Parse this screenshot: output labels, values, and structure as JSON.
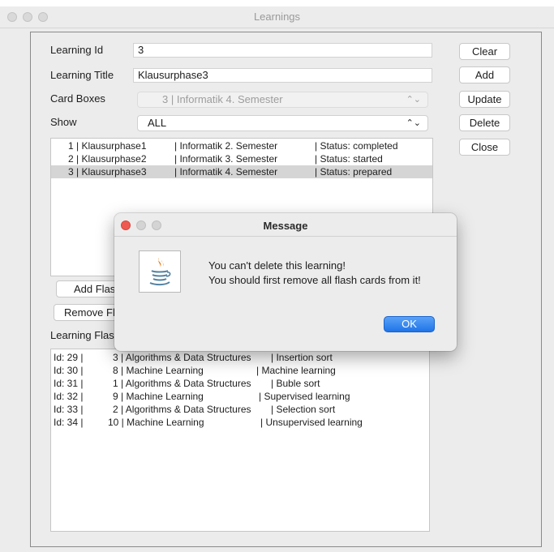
{
  "window": {
    "title": "Learnings"
  },
  "form": {
    "learning_id_label": "Learning Id",
    "learning_id_value": "3",
    "learning_title_label": "Learning Title",
    "learning_title_value": "Klausurphase3",
    "card_boxes_label": "Card Boxes",
    "card_boxes_value": "3 | Informatik 4. Semester",
    "show_label": "Show",
    "show_value": "ALL"
  },
  "buttons": {
    "clear": "Clear",
    "add": "Add",
    "update": "Update",
    "delete": "Delete",
    "close": "Close",
    "add_flash": "Add Flas",
    "remove_flash": "Remove Fl"
  },
  "learnings": [
    {
      "id": "1 | Klausurphase1",
      "box": "| Informatik 2. Semester",
      "status": "| Status: completed"
    },
    {
      "id": "2 | Klausurphase2",
      "box": "| Informatik 3. Semester",
      "status": "| Status: started"
    },
    {
      "id": "3 | Klausurphase3",
      "box": "| Informatik 4. Semester",
      "status": "| Status: prepared"
    }
  ],
  "flash_section_label": "Learning Flas",
  "flash_cards": [
    {
      "id": "Id:   29 |",
      "box": "3 | Algorithms & Data Structures",
      "name": "| Insertion sort"
    },
    {
      "id": "Id:   30 |",
      "box": "8 | Machine Learning",
      "name": "| Machine learning"
    },
    {
      "id": "Id:   31 |",
      "box": "1 | Algorithms & Data Structures",
      "name": "| Buble sort"
    },
    {
      "id": "Id:   32 |",
      "box": "9 | Machine Learning",
      "name": "| Supervised learning"
    },
    {
      "id": "Id:   33 |",
      "box": "2 | Algorithms & Data Structures",
      "name": "| Selection sort"
    },
    {
      "id": "Id:   34 |",
      "box": "10 | Machine Learning",
      "name": "| Unsupervised learning"
    }
  ],
  "dialog": {
    "title": "Message",
    "line1": "You can't delete this learning!",
    "line2": "You should first remove all flash cards from it!",
    "ok": "OK",
    "icon": "java-icon"
  },
  "colors": {
    "accent": "#1f74e8",
    "close_red": "#ee5a52",
    "selection": "#d5d5d5"
  }
}
